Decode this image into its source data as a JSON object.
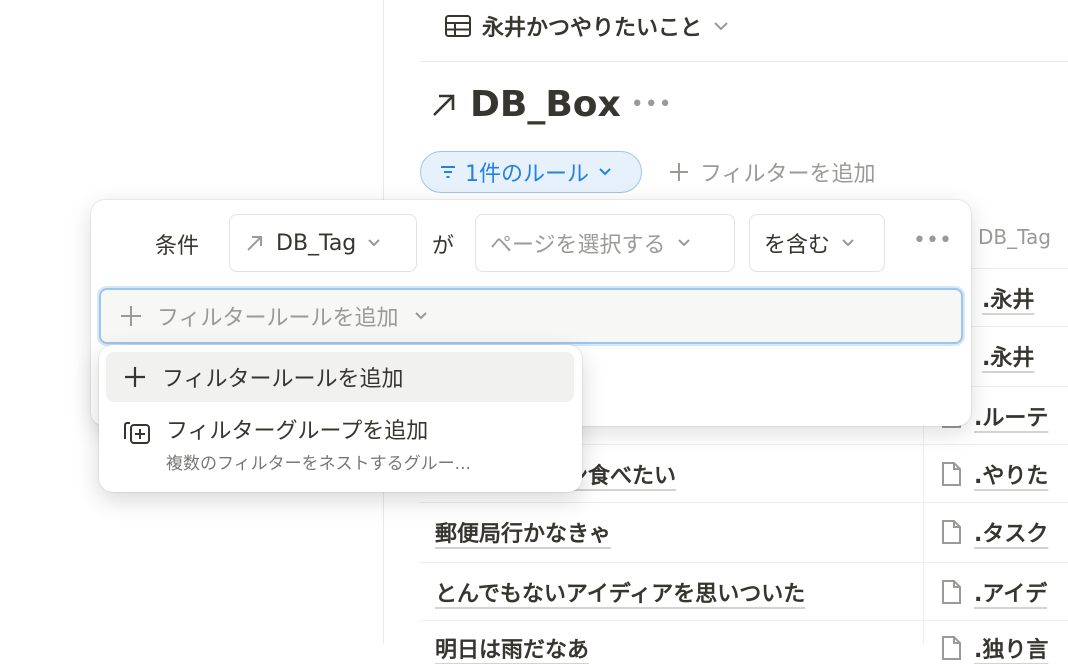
{
  "view": {
    "title": "永井かつやりたいこと"
  },
  "database": {
    "title": "DB_Box"
  },
  "filter_bar": {
    "rule_count_label": "1件のルール",
    "add_filter_label": "フィルターを追加"
  },
  "background_table": {
    "tag_column_header": "DB_Tag",
    "rows": [
      {
        "name": "",
        "tag": ".永井"
      },
      {
        "name": "",
        "tag": ".永井"
      },
      {
        "name": "",
        "tag": ".ルーテ"
      },
      {
        "name": "ン食べたい",
        "tag": ".やりた"
      },
      {
        "name": "郵便局行かなきゃ",
        "tag": ".タスク"
      },
      {
        "name": "とんでもないアイディアを思いついた",
        "tag": ".アイデ"
      },
      {
        "name": "明日は雨だなあ",
        "tag": ".独り言"
      }
    ]
  },
  "filter_panel": {
    "condition_label": "条件",
    "property_select": "DB_Tag",
    "particle": "が",
    "value_placeholder": "ページを選択する",
    "operator_select": "を含む",
    "add_rule_placeholder": "フィルタールールを追加"
  },
  "dropdown": {
    "items": [
      {
        "label": "フィルタールールを追加",
        "icon": "plus-icon"
      },
      {
        "label": "フィルターグループを追加",
        "description": "複数のフィルターをネストするグルー...",
        "icon": "filter-group-icon"
      }
    ]
  },
  "colors": {
    "accent": "#2383e2",
    "pill_bg": "#e7f1fb",
    "text": "#37352f",
    "muted": "#9b9a97"
  }
}
